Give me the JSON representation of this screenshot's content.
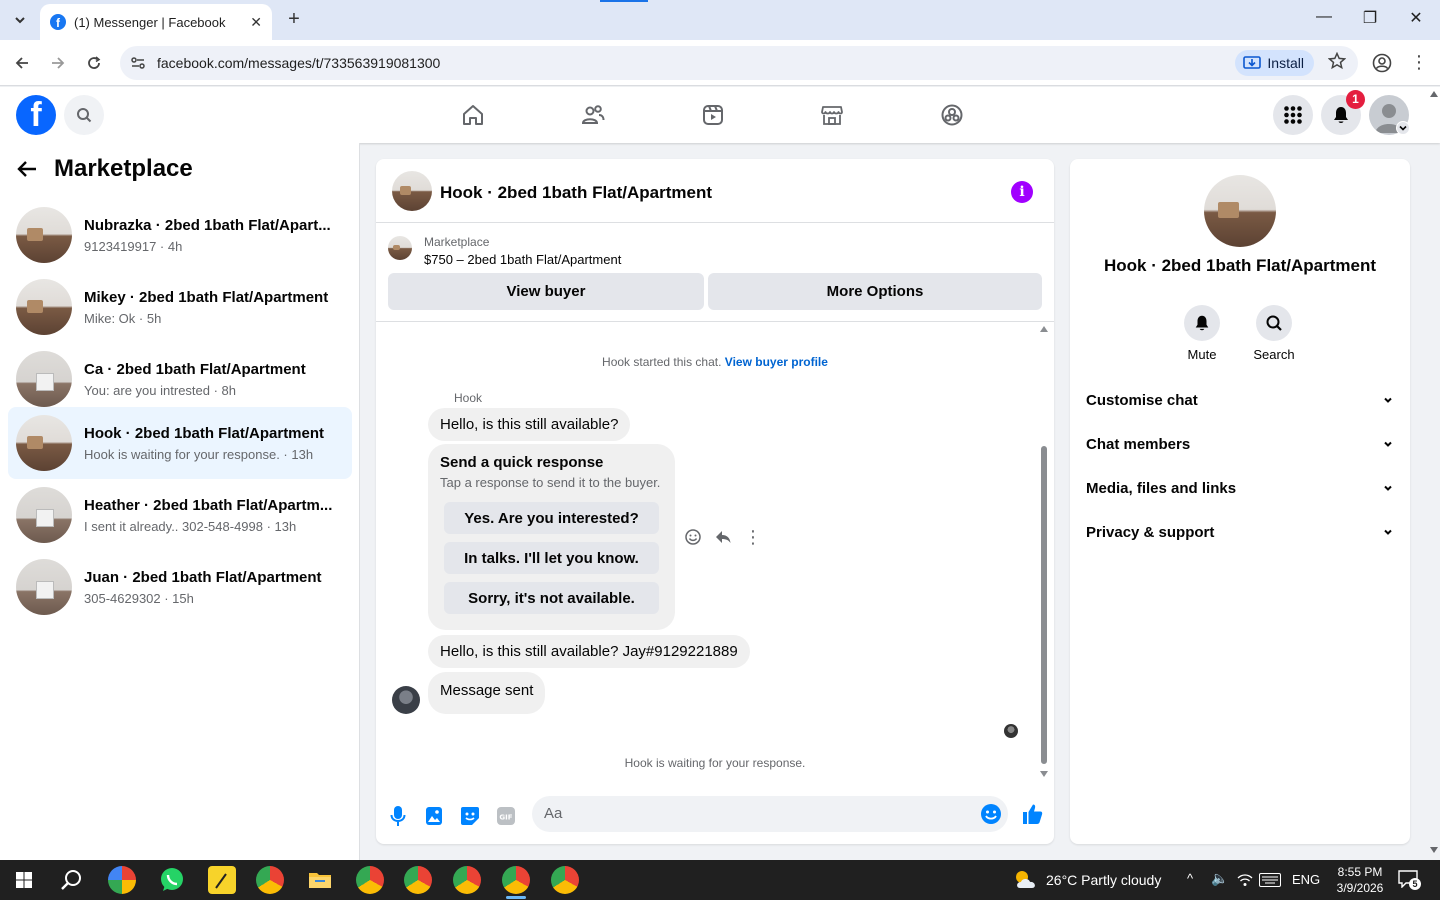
{
  "browser": {
    "tab_title": "(1) Messenger | Facebook",
    "url": "facebook.com/messages/t/733563919081300",
    "install_label": "Install"
  },
  "fb": {
    "notification_count": "1"
  },
  "left": {
    "title": "Marketplace",
    "conversations": [
      {
        "name": "Nubrazka · 2bed 1bath Flat/Apart...",
        "sub": "9123419917 · 4h",
        "thumb": "room"
      },
      {
        "name": "Mikey · 2bed 1bath Flat/Apartment",
        "sub": "Mike: Ok · 5h",
        "thumb": "room"
      },
      {
        "name": "Ca · 2bed 1bath Flat/Apartment",
        "sub": "You: are you intrested · 8h",
        "thumb": "room2"
      },
      {
        "name": "Hook · 2bed 1bath Flat/Apartment",
        "sub": "Hook is waiting for your response. · 13h",
        "thumb": "room",
        "active": true
      },
      {
        "name": "Heather · 2bed 1bath Flat/Apartm...",
        "sub": "I sent it already.. 302-548-4998 · 13h",
        "thumb": "room2"
      },
      {
        "name": "Juan · 2bed 1bath Flat/Apartment",
        "sub": "305-4629302 · 15h",
        "thumb": "room2"
      }
    ]
  },
  "chat": {
    "title": "Hook · 2bed 1bath Flat/Apartment",
    "marketplace_label": "Marketplace",
    "listing": "$750 – 2bed 1bath Flat/Apartment",
    "view_buyer": "View buyer",
    "more_options": "More Options",
    "started_text": "Hook started this chat.",
    "view_profile": "View buyer profile",
    "sender": "Hook",
    "msg1": "Hello, is this still available?",
    "quick_title": "Send a quick response",
    "quick_sub": "Tap a response to send it to the buyer.",
    "quick_options": [
      "Yes. Are you interested?",
      "In talks. I'll let you know.",
      "Sorry, it's not available."
    ],
    "msg2": "Hello, is this still available? Jay#9129221889",
    "msg3": "Message sent",
    "waiting": "Hook is waiting for your response.",
    "composer_placeholder": "Aa"
  },
  "right": {
    "name": "Hook · 2bed 1bath Flat/Apartment",
    "mute": "Mute",
    "search": "Search",
    "sections": [
      "Customise chat",
      "Chat members",
      "Media, files and links",
      "Privacy & support"
    ]
  },
  "taskbar": {
    "weather": "26°C  Partly cloudy",
    "lang": "ENG",
    "time": "8:55 PM",
    "date": "3/9/2026",
    "notif_count": "5"
  },
  "colors": {
    "fb_blue": "#0866ff",
    "messenger_blue": "#0084ff",
    "active_row": "#ebf5ff",
    "info_purple": "#a100ff",
    "badge_red": "#e41e3f"
  }
}
